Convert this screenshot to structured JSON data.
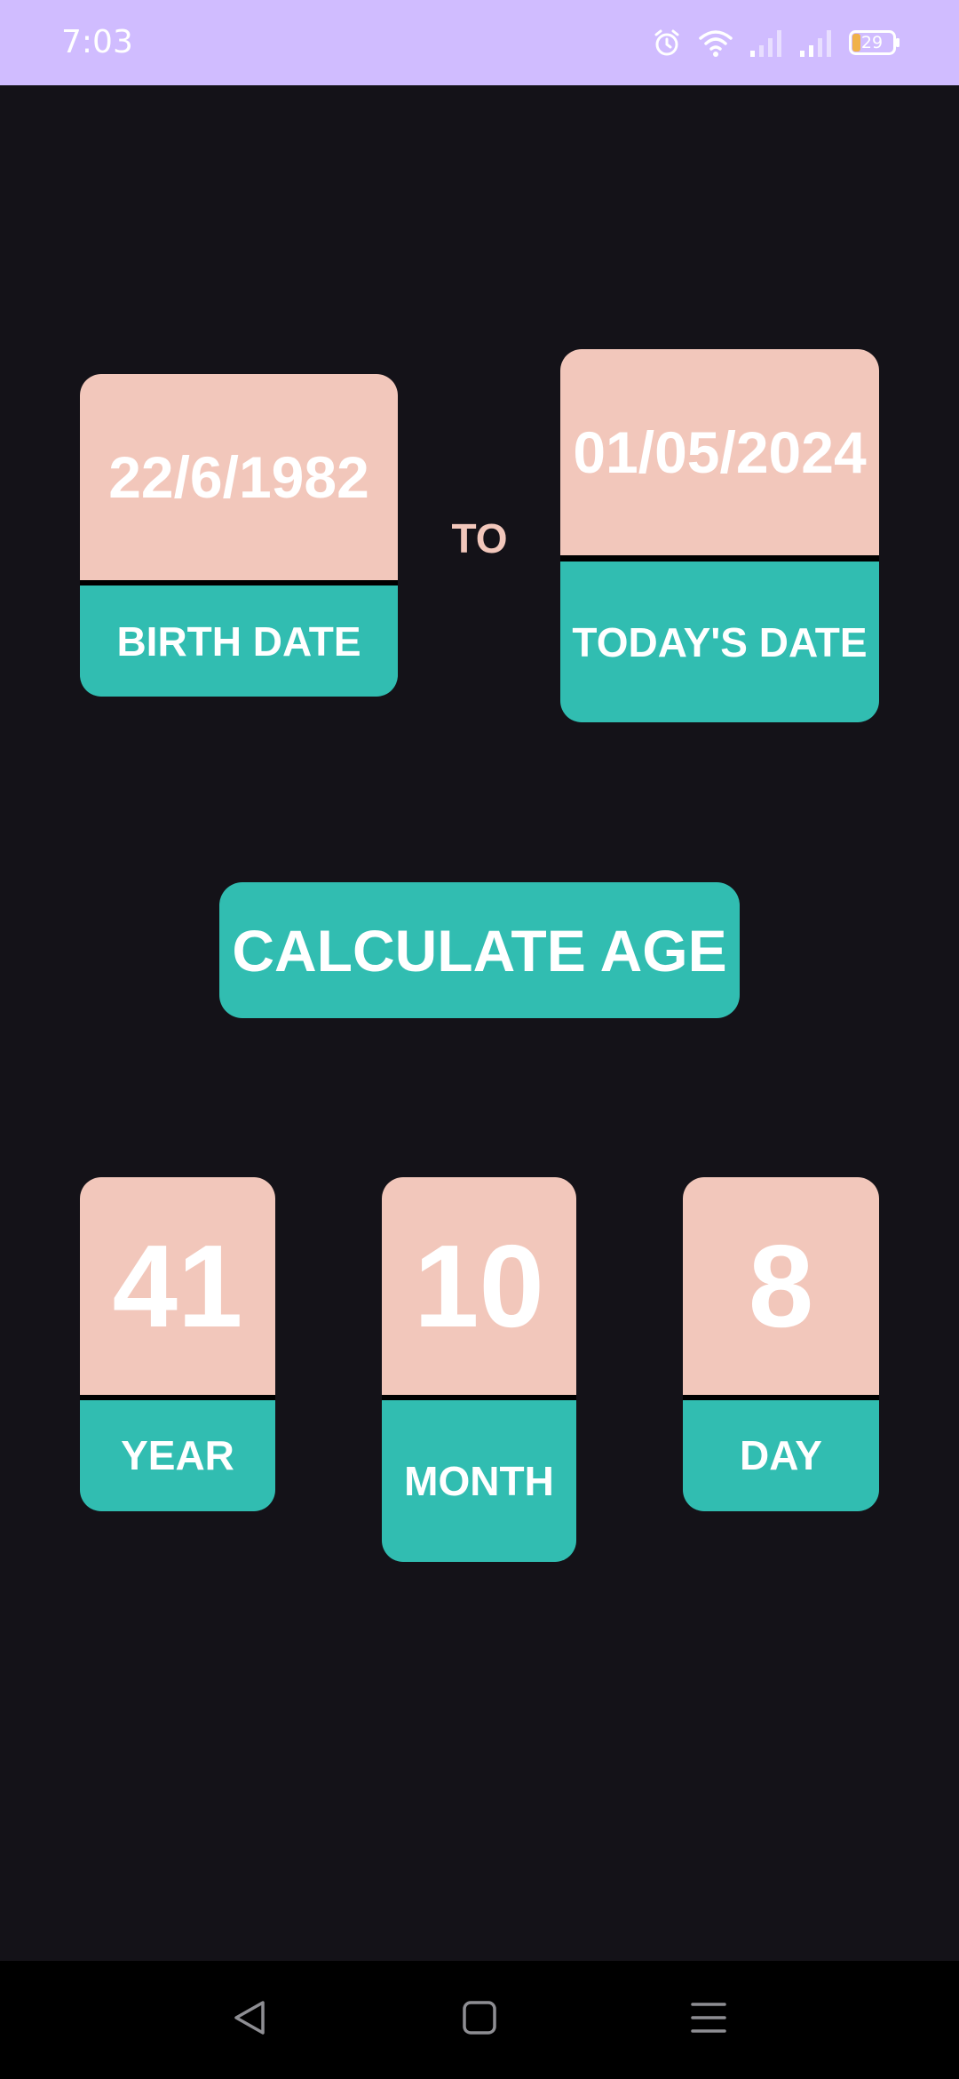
{
  "status_bar": {
    "time": "7:03",
    "battery_level": "29",
    "icons": [
      "alarm-icon",
      "wifi-icon",
      "signal-icon",
      "signal-icon",
      "battery-icon"
    ]
  },
  "birth_date": {
    "value": "22/6/1982",
    "label": "BIRTH DATE"
  },
  "separator": "TO",
  "todays_date": {
    "value": "01/05/2024",
    "label": "TODAY'S DATE"
  },
  "calculate_button": {
    "label": "CALCULATE AGE"
  },
  "results": {
    "year": {
      "value": "41",
      "label": "YEAR"
    },
    "month": {
      "value": "10",
      "label": "MONTH"
    },
    "day": {
      "value": "8",
      "label": "DAY"
    }
  },
  "nav_bar": {
    "icons": [
      "back-icon",
      "home-icon",
      "recents-icon"
    ]
  },
  "colors": {
    "background": "#141218",
    "status_bar": "#d0bcff",
    "card_top": "#f2c7bb",
    "card_bottom": "#31bdb1",
    "text": "#ffffff"
  }
}
